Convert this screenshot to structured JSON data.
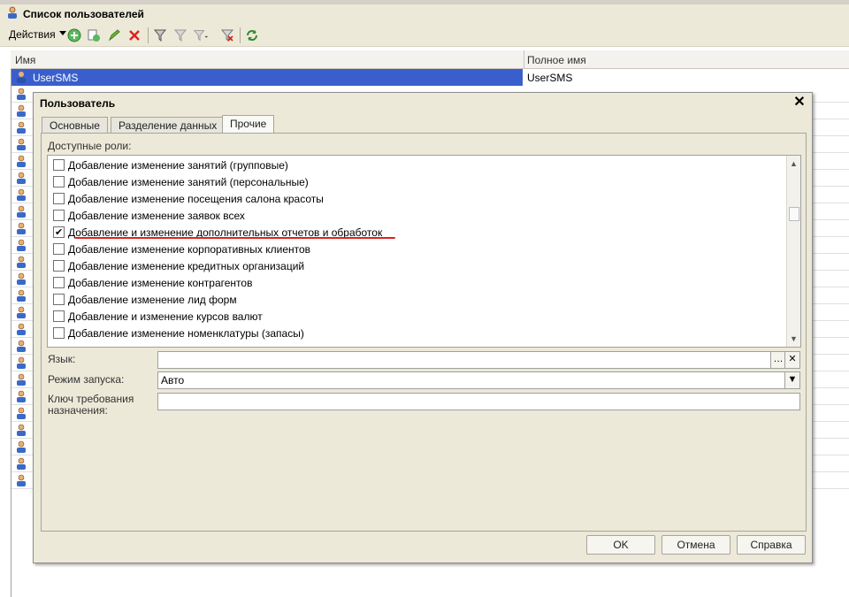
{
  "window": {
    "title": "Список пользователей"
  },
  "toolbar": {
    "actions_label": "Действия"
  },
  "list": {
    "columns": [
      "Имя",
      "Полное имя"
    ],
    "selected_row": {
      "name": "UserSMS",
      "full_name": "UserSMS"
    }
  },
  "dialog": {
    "title": "Пользователь",
    "tabs": [
      "Основные",
      "Разделение данных",
      "Прочие"
    ],
    "active_tab": "Прочие",
    "roles_label": "Доступные роли:",
    "roles": [
      {
        "label": "Добавление изменение занятий (групповые)",
        "checked": false
      },
      {
        "label": "Добавление изменение занятий (персональные)",
        "checked": false
      },
      {
        "label": "Добавление изменение посещения салона красоты",
        "checked": false
      },
      {
        "label": "Добавление изменение заявок всех",
        "checked": false
      },
      {
        "label": "Добавление и изменение дополнительных отчетов и обработок",
        "checked": true
      },
      {
        "label": "Добавление изменение корпоративных клиентов",
        "checked": false
      },
      {
        "label": "Добавление изменение кредитных организаций",
        "checked": false
      },
      {
        "label": "Добавление изменение контрагентов",
        "checked": false
      },
      {
        "label": "Добавление изменение лид форм",
        "checked": false
      },
      {
        "label": "Добавление и изменение курсов валют",
        "checked": false
      },
      {
        "label": "Добавление изменение номенклатуры (запасы)",
        "checked": false
      }
    ],
    "fields": {
      "language_label": "Язык:",
      "language_value": "",
      "startup_mode_label": "Режим запуска:",
      "startup_mode_value": "Авто",
      "key_label": "Ключ требования назначения:",
      "key_value": ""
    },
    "buttons": {
      "ok": "OK",
      "cancel": "Отмена",
      "help": "Справка"
    }
  },
  "colors": {
    "selection": "#3a5fcd",
    "highlight_underline": "#e02020",
    "window_bg": "#ece9d8"
  }
}
